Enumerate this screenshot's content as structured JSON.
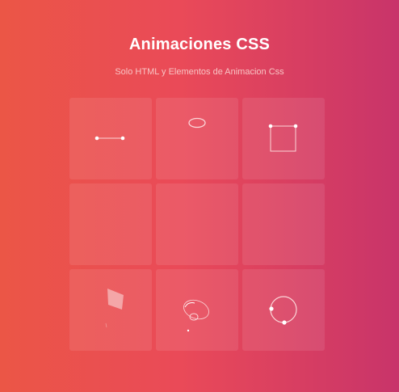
{
  "header": {
    "title": "Animaciones CSS",
    "subtitle": "Solo HTML y Elementos de Animacion Css"
  },
  "grid": {
    "cells": [
      {
        "icon": "dumbbell-line-icon"
      },
      {
        "icon": "ellipse-ring-icon"
      },
      {
        "icon": "square-outline-icon"
      },
      {
        "icon": "empty"
      },
      {
        "icon": "empty"
      },
      {
        "icon": "empty"
      },
      {
        "icon": "parallelogram-icon"
      },
      {
        "icon": "spiral-rings-icon"
      },
      {
        "icon": "orbit-circle-icon"
      }
    ]
  },
  "colors": {
    "gradient_start": "#eb5646",
    "gradient_end": "#c8346a",
    "cell_tint": "rgba(255,255,255,0.09)",
    "shape_stroke": "#fbd6d8"
  }
}
